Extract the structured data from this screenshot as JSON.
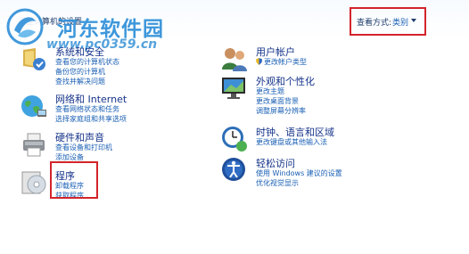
{
  "header": {
    "heading": "调整计算机的设置",
    "view_by_label": "查看方式:",
    "view_by_value": "类别"
  },
  "watermark": {
    "title": "河东软件园",
    "url": "www.pc0359.cn"
  },
  "categories": {
    "system": {
      "title": "系统和安全",
      "links": [
        "查看您的计算机状态",
        "备份您的计算机",
        "查找并解决问题"
      ]
    },
    "network": {
      "title": "网络和 Internet",
      "links": [
        "查看网络状态和任务",
        "选择家庭组和共享选项"
      ]
    },
    "hardware": {
      "title": "硬件和声音",
      "links": [
        "查看设备和打印机",
        "添加设备"
      ]
    },
    "programs": {
      "title": "程序",
      "links": [
        "卸载程序",
        "获取程序"
      ]
    },
    "accounts": {
      "title": "用户帐户",
      "links": [
        "更改帐户类型"
      ]
    },
    "appearance": {
      "title": "外观和个性化",
      "links": [
        "更改主题",
        "更改桌面背景",
        "调整屏幕分辨率"
      ]
    },
    "clock": {
      "title": "时钟、语言和区域",
      "links": [
        "更改键盘或其他输入法"
      ]
    },
    "ease": {
      "title": "轻松访问",
      "links": [
        "使用 Windows 建议的设置",
        "优化视觉显示"
      ]
    }
  },
  "colors": {
    "highlight": "#d3242b",
    "link": "#1a5fb4",
    "title": "#15338a"
  }
}
